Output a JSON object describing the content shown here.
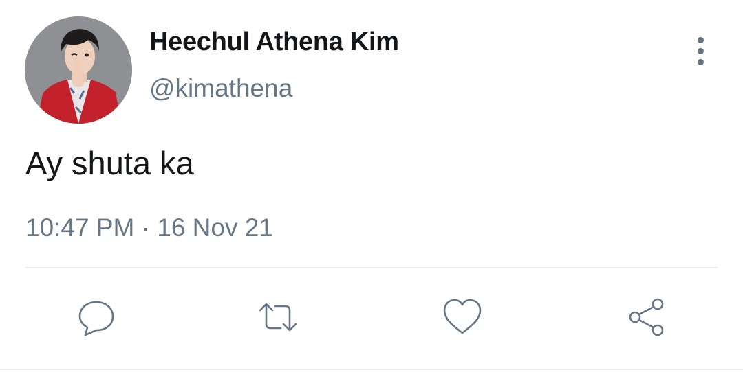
{
  "author": {
    "display_name": "Heechul Athena Kim",
    "handle": "@kimathena"
  },
  "tweet": {
    "text": "Ay shuta ka",
    "timestamp": "10:47 PM · 16 Nov 21"
  },
  "actions": [
    {
      "name": "reply",
      "icon": "reply-icon"
    },
    {
      "name": "retweet",
      "icon": "retweet-icon"
    },
    {
      "name": "like",
      "icon": "heart-icon"
    },
    {
      "name": "share",
      "icon": "share-icon"
    }
  ],
  "colors": {
    "text_primary": "#14171a",
    "text_secondary": "#657786",
    "divider": "#e6ecf0",
    "background": "#ffffff"
  }
}
